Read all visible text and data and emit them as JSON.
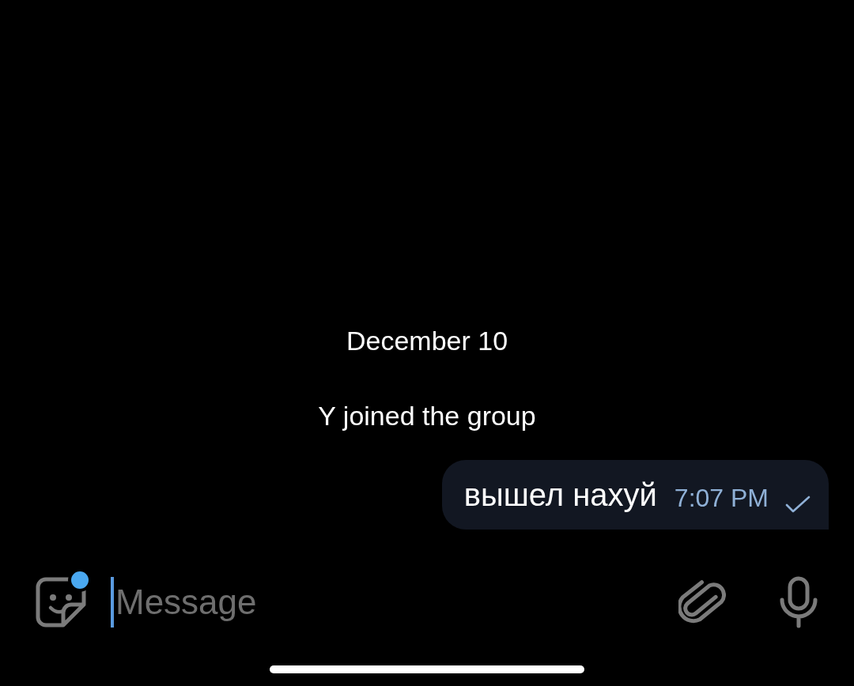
{
  "date_label": "December 10",
  "service_message": "Y joined the group",
  "messages": [
    {
      "text": "вышел нахуй",
      "time": "7:07 PM",
      "read": false
    }
  ],
  "composer": {
    "placeholder": "Message",
    "sticker_badge": true
  }
}
